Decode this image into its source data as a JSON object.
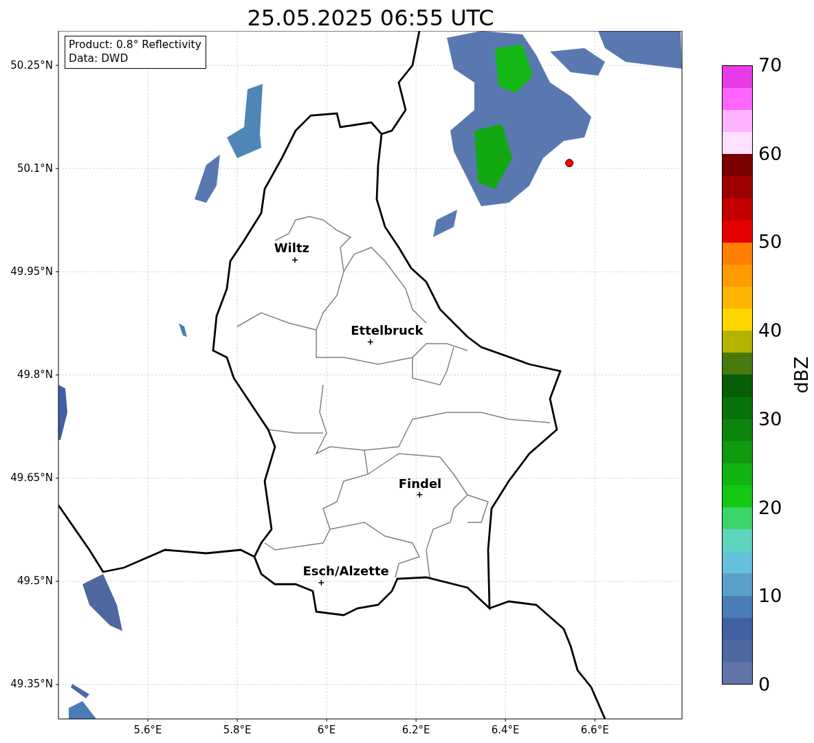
{
  "title": "25.05.2025 06:55 UTC",
  "map": {
    "info_box": [
      "Product: 0.8° Reflectivity",
      "Data: DWD"
    ],
    "city_labels": [
      "Wiltz",
      "Ettelbruck",
      "Findel",
      "Esch/Alzette"
    ],
    "x_ticks": [
      "5.6°E",
      "5.8°E",
      "6°E",
      "6.2°E",
      "6.4°E",
      "6.6°E"
    ],
    "y_ticks": [
      "50.25°N",
      "50.1°N",
      "49.95°N",
      "49.8°N",
      "49.65°N",
      "49.5°N",
      "49.35°N"
    ]
  },
  "colorbar": {
    "label": "dBZ",
    "ticks": [
      "70",
      "60",
      "50",
      "40",
      "30",
      "20",
      "10",
      "0"
    ]
  }
}
